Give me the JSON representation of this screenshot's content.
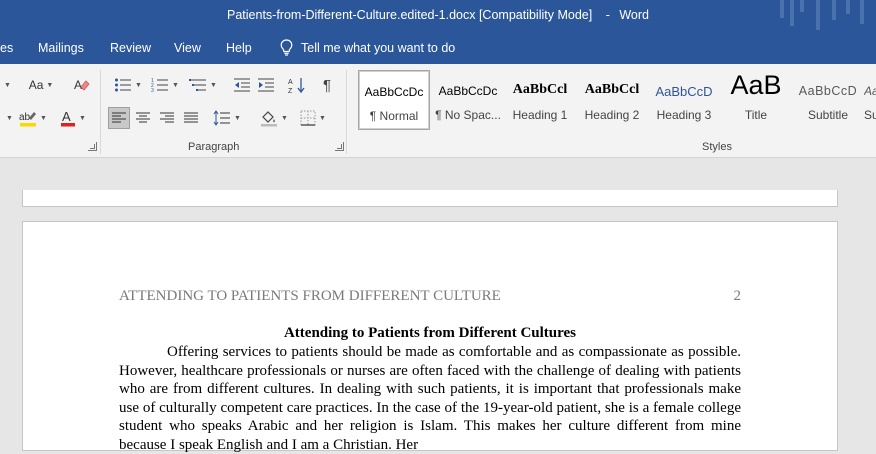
{
  "window": {
    "document_name": "Patients-from-Different-Culture.edited-1.docx [Compatibility Mode]",
    "separator": "-",
    "app_name": "Word"
  },
  "menu": {
    "tabs": [
      "es",
      "Mailings",
      "Review",
      "View",
      "Help"
    ],
    "tell_me": "Tell me what you want to do"
  },
  "ribbon": {
    "groups": {
      "paragraph": "Paragraph",
      "styles": "Styles"
    },
    "font_buttons": {
      "change_case": "Aa"
    },
    "styles": [
      {
        "sample": "AaBbCcDc",
        "name": "¶ Normal"
      },
      {
        "sample": "AaBbCcDc",
        "name": "¶ No Spac..."
      },
      {
        "sample": "AaBbCcl",
        "name": "Heading 1"
      },
      {
        "sample": "AaBbCcl",
        "name": "Heading 2"
      },
      {
        "sample": "AaBbCcD",
        "name": "Heading 3"
      },
      {
        "sample": "AaB",
        "name": "Title"
      },
      {
        "sample": "AaBbCcD",
        "name": "Subtitle"
      },
      {
        "sample": "AaBb",
        "name": "Su"
      }
    ]
  },
  "document": {
    "running_head": "ATTENDING TO PATIENTS FROM DIFFERENT CULTURE",
    "page_number": "2",
    "title": "Attending to Patients from Different Cultures",
    "body": "Offering services to patients should be made as comfortable and as compassionate as possible. However, healthcare professionals or nurses are often faced with the challenge of dealing with patients who are from different cultures. In dealing with such patients, it is important that professionals make use of culturally competent care practices. In the case of the 19-year-old patient, she is a female college student who speaks Arabic and her religion is Islam. This makes her culture different from mine because I speak English and I am a Christian. Her"
  },
  "colors": {
    "title_bar": "#2b579a",
    "ribbon_bg": "#f3f3f3",
    "doc_bg": "#e6e6e6",
    "page": "#ffffff",
    "header_text": "#7a7a7a",
    "highlight_yellow": "#ffd700",
    "font_color_red": "#e02020"
  }
}
